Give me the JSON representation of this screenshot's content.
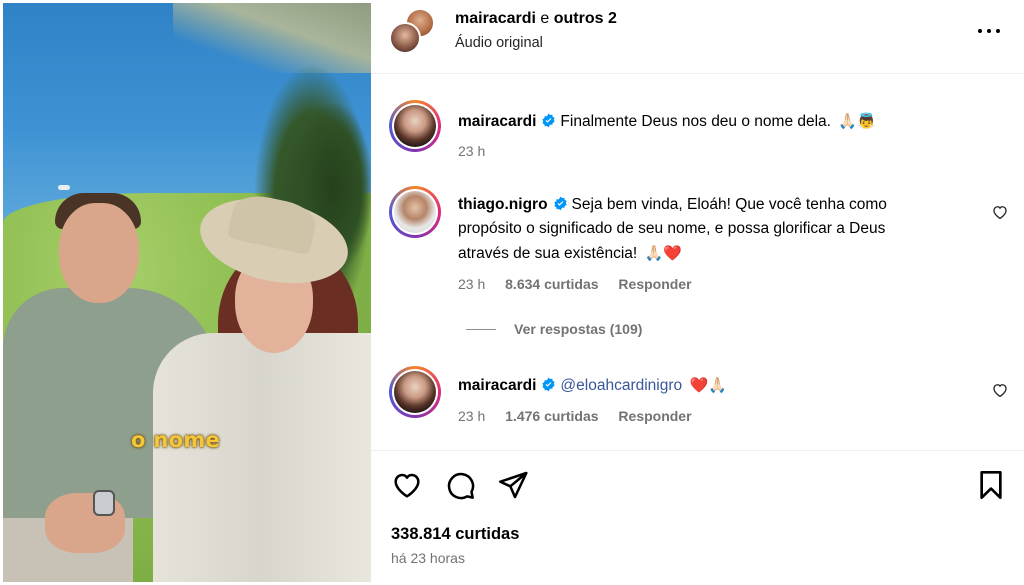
{
  "header": {
    "username": "mairacardi",
    "connector": "e",
    "others": "outros 2",
    "audio": "Áudio original"
  },
  "media": {
    "caption": "o nome"
  },
  "comments": [
    {
      "username": "mairacardi",
      "verified": true,
      "text": "Finalmente Deus nos deu o nome dela.",
      "emojis": "🙏🏻👼",
      "time": "23 h"
    },
    {
      "username": "thiago.nigro",
      "verified": true,
      "text_line1": "Seja bem vinda, Eloáh! Que você tenha como",
      "text_line2": "propósito o significado de seu nome, e possa glorificar a Deus",
      "text_line3": "através de sua existência!",
      "emojis": "🙏🏻❤️",
      "time": "23 h",
      "likes": "8.634 curtidas",
      "reply": "Responder"
    },
    {
      "username": "mairacardi",
      "verified": true,
      "mention": "@eloahcardinigro",
      "emojis": "❤️🙏🏻",
      "time": "23 h",
      "likes": "1.476 curtidas",
      "reply": "Responder"
    }
  ],
  "view_replies": "Ver respostas (109)",
  "footer": {
    "likes": "338.814 curtidas",
    "time": "há 23 horas"
  },
  "colors": {
    "verified": "#0095f6",
    "secondary_text": "#737373",
    "mention": "#385898",
    "caption": "#f5c63a"
  }
}
